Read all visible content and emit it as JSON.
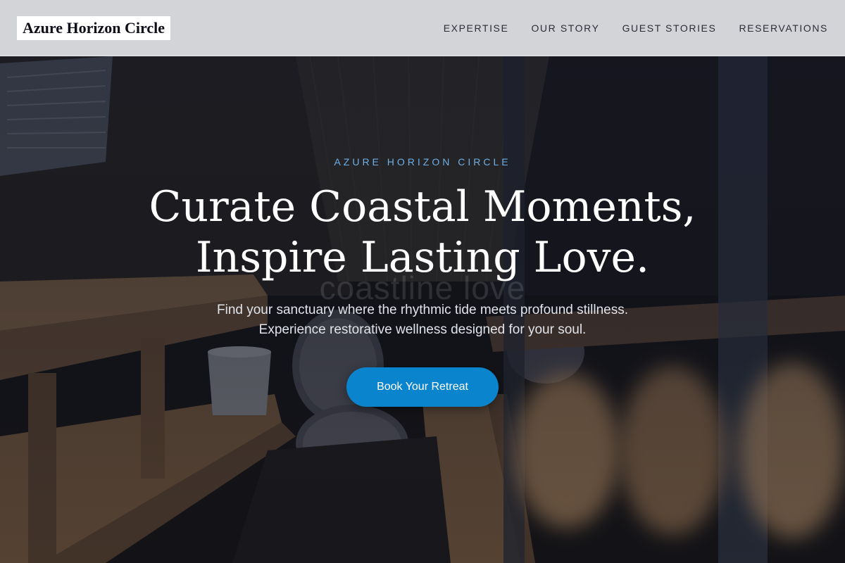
{
  "header": {
    "brand": "Azure Horizon Circle",
    "nav": [
      {
        "label": "EXPERTISE"
      },
      {
        "label": "OUR STORY"
      },
      {
        "label": "GUEST STORIES"
      },
      {
        "label": "RESERVATIONS"
      }
    ]
  },
  "hero": {
    "eyebrow": "AZURE HORIZON CIRCLE",
    "headline_line1": "Curate Coastal Moments,",
    "headline_line2": "Inspire Lasting Love.",
    "ghost_text": "coastline love",
    "subtext_line1": "Find your sanctuary where the rhythmic tide meets profound stillness.",
    "subtext_line2": "Experience restorative wellness designed for your soul.",
    "cta_label": "Book Your Retreat"
  },
  "colors": {
    "accent": "#0a84cc",
    "eyebrow": "#6fb0e6",
    "header_bg": "#e2e3e6",
    "headline": "#ffffff"
  }
}
